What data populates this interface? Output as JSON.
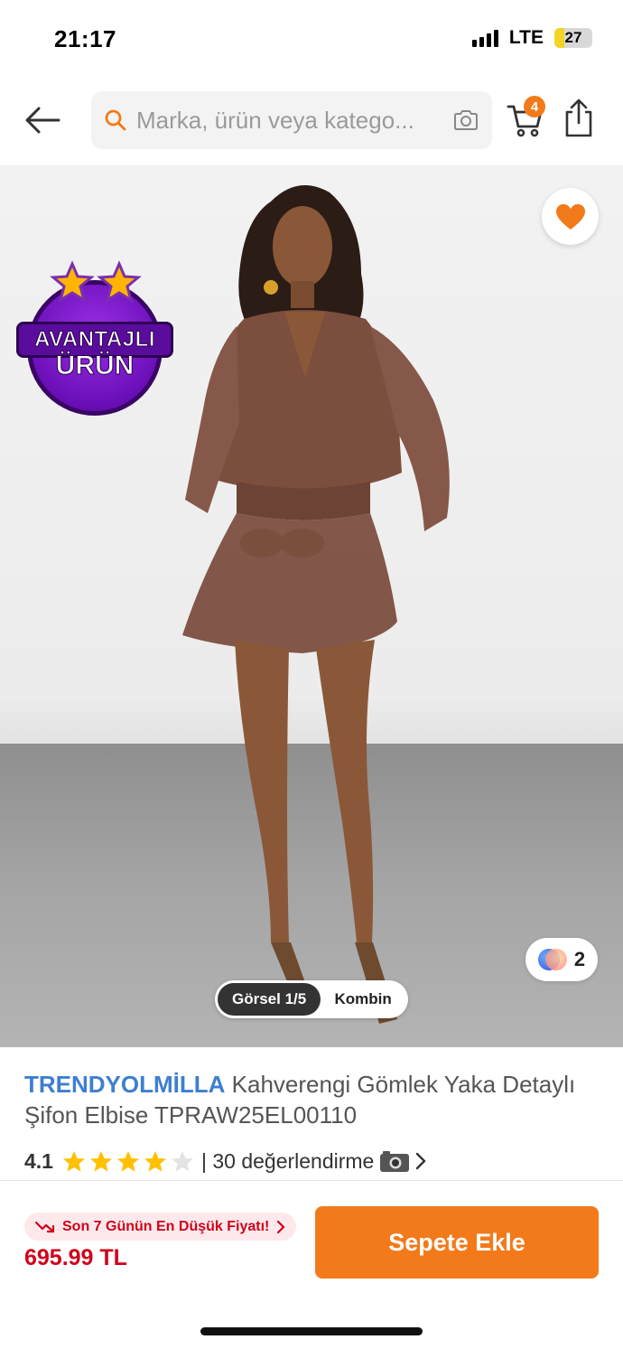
{
  "status_bar": {
    "time": "21:17",
    "network": "LTE",
    "battery": "27",
    "battery_fraction": 0.27
  },
  "nav": {
    "back_icon": "arrow-left-icon",
    "search_placeholder": "Marka, ürün veya katego...",
    "search_icon": "search-icon",
    "camera_icon": "camera-icon",
    "cart_icon": "cart-icon",
    "cart_count": "4",
    "share_icon": "share-icon"
  },
  "product_image": {
    "badge_line1": "AVANTAJLI",
    "badge_line2": "ÜRÜN",
    "favorite_icon": "heart-icon",
    "color_count": "2",
    "tabs": [
      "Görsel 1/5",
      "Kombin"
    ]
  },
  "product": {
    "brand": "TRENDYOLMİLLA",
    "title": "Kahverengi Gömlek Yaka Detaylı Şifon Elbise TPRAW25EL00110",
    "rating": "4.1",
    "rating_value": 4.1,
    "rating_max": 5,
    "review_text": "| 30 değerlendirme"
  },
  "bottom_bar": {
    "lowest_price_text": "Son 7 Günün En Düşük Fiyatı!",
    "price": "695.99 TL",
    "add_to_cart": "Sepete Ekle"
  },
  "colors": {
    "accent": "#f27a1a",
    "brand_link": "#3d7fd1",
    "price_red": "#d0021b",
    "badge_purple": "#6a0fb8"
  }
}
